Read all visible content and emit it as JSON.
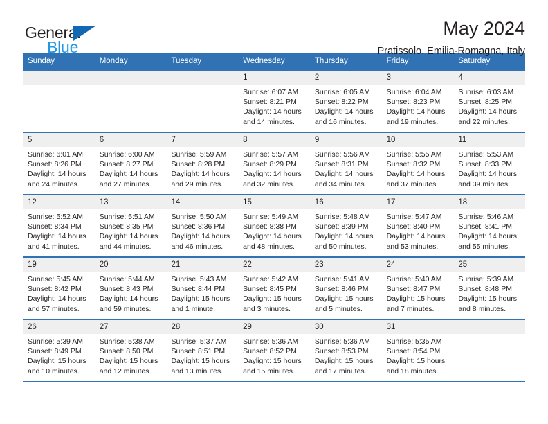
{
  "brand": {
    "name_part1": "General",
    "name_part2": "Blue",
    "triangle_color": "#1268b3",
    "blue_text_color": "#2196e3"
  },
  "header": {
    "title": "May 2024",
    "subtitle": "Pratissolo, Emilia-Romagna, Italy"
  },
  "calendar": {
    "accent_color": "#3072b3",
    "daynum_bg": "#efefef",
    "weekdays": [
      "Sunday",
      "Monday",
      "Tuesday",
      "Wednesday",
      "Thursday",
      "Friday",
      "Saturday"
    ],
    "weeks": [
      [
        {
          "day": "",
          "empty": true
        },
        {
          "day": "",
          "empty": true
        },
        {
          "day": "",
          "empty": true
        },
        {
          "day": "1",
          "sunrise": "Sunrise: 6:07 AM",
          "sunset": "Sunset: 8:21 PM",
          "daylight": "Daylight: 14 hours and 14 minutes."
        },
        {
          "day": "2",
          "sunrise": "Sunrise: 6:05 AM",
          "sunset": "Sunset: 8:22 PM",
          "daylight": "Daylight: 14 hours and 16 minutes."
        },
        {
          "day": "3",
          "sunrise": "Sunrise: 6:04 AM",
          "sunset": "Sunset: 8:23 PM",
          "daylight": "Daylight: 14 hours and 19 minutes."
        },
        {
          "day": "4",
          "sunrise": "Sunrise: 6:03 AM",
          "sunset": "Sunset: 8:25 PM",
          "daylight": "Daylight: 14 hours and 22 minutes."
        }
      ],
      [
        {
          "day": "5",
          "sunrise": "Sunrise: 6:01 AM",
          "sunset": "Sunset: 8:26 PM",
          "daylight": "Daylight: 14 hours and 24 minutes."
        },
        {
          "day": "6",
          "sunrise": "Sunrise: 6:00 AM",
          "sunset": "Sunset: 8:27 PM",
          "daylight": "Daylight: 14 hours and 27 minutes."
        },
        {
          "day": "7",
          "sunrise": "Sunrise: 5:59 AM",
          "sunset": "Sunset: 8:28 PM",
          "daylight": "Daylight: 14 hours and 29 minutes."
        },
        {
          "day": "8",
          "sunrise": "Sunrise: 5:57 AM",
          "sunset": "Sunset: 8:29 PM",
          "daylight": "Daylight: 14 hours and 32 minutes."
        },
        {
          "day": "9",
          "sunrise": "Sunrise: 5:56 AM",
          "sunset": "Sunset: 8:31 PM",
          "daylight": "Daylight: 14 hours and 34 minutes."
        },
        {
          "day": "10",
          "sunrise": "Sunrise: 5:55 AM",
          "sunset": "Sunset: 8:32 PM",
          "daylight": "Daylight: 14 hours and 37 minutes."
        },
        {
          "day": "11",
          "sunrise": "Sunrise: 5:53 AM",
          "sunset": "Sunset: 8:33 PM",
          "daylight": "Daylight: 14 hours and 39 minutes."
        }
      ],
      [
        {
          "day": "12",
          "sunrise": "Sunrise: 5:52 AM",
          "sunset": "Sunset: 8:34 PM",
          "daylight": "Daylight: 14 hours and 41 minutes."
        },
        {
          "day": "13",
          "sunrise": "Sunrise: 5:51 AM",
          "sunset": "Sunset: 8:35 PM",
          "daylight": "Daylight: 14 hours and 44 minutes."
        },
        {
          "day": "14",
          "sunrise": "Sunrise: 5:50 AM",
          "sunset": "Sunset: 8:36 PM",
          "daylight": "Daylight: 14 hours and 46 minutes."
        },
        {
          "day": "15",
          "sunrise": "Sunrise: 5:49 AM",
          "sunset": "Sunset: 8:38 PM",
          "daylight": "Daylight: 14 hours and 48 minutes."
        },
        {
          "day": "16",
          "sunrise": "Sunrise: 5:48 AM",
          "sunset": "Sunset: 8:39 PM",
          "daylight": "Daylight: 14 hours and 50 minutes."
        },
        {
          "day": "17",
          "sunrise": "Sunrise: 5:47 AM",
          "sunset": "Sunset: 8:40 PM",
          "daylight": "Daylight: 14 hours and 53 minutes."
        },
        {
          "day": "18",
          "sunrise": "Sunrise: 5:46 AM",
          "sunset": "Sunset: 8:41 PM",
          "daylight": "Daylight: 14 hours and 55 minutes."
        }
      ],
      [
        {
          "day": "19",
          "sunrise": "Sunrise: 5:45 AM",
          "sunset": "Sunset: 8:42 PM",
          "daylight": "Daylight: 14 hours and 57 minutes."
        },
        {
          "day": "20",
          "sunrise": "Sunrise: 5:44 AM",
          "sunset": "Sunset: 8:43 PM",
          "daylight": "Daylight: 14 hours and 59 minutes."
        },
        {
          "day": "21",
          "sunrise": "Sunrise: 5:43 AM",
          "sunset": "Sunset: 8:44 PM",
          "daylight": "Daylight: 15 hours and 1 minute."
        },
        {
          "day": "22",
          "sunrise": "Sunrise: 5:42 AM",
          "sunset": "Sunset: 8:45 PM",
          "daylight": "Daylight: 15 hours and 3 minutes."
        },
        {
          "day": "23",
          "sunrise": "Sunrise: 5:41 AM",
          "sunset": "Sunset: 8:46 PM",
          "daylight": "Daylight: 15 hours and 5 minutes."
        },
        {
          "day": "24",
          "sunrise": "Sunrise: 5:40 AM",
          "sunset": "Sunset: 8:47 PM",
          "daylight": "Daylight: 15 hours and 7 minutes."
        },
        {
          "day": "25",
          "sunrise": "Sunrise: 5:39 AM",
          "sunset": "Sunset: 8:48 PM",
          "daylight": "Daylight: 15 hours and 8 minutes."
        }
      ],
      [
        {
          "day": "26",
          "sunrise": "Sunrise: 5:39 AM",
          "sunset": "Sunset: 8:49 PM",
          "daylight": "Daylight: 15 hours and 10 minutes."
        },
        {
          "day": "27",
          "sunrise": "Sunrise: 5:38 AM",
          "sunset": "Sunset: 8:50 PM",
          "daylight": "Daylight: 15 hours and 12 minutes."
        },
        {
          "day": "28",
          "sunrise": "Sunrise: 5:37 AM",
          "sunset": "Sunset: 8:51 PM",
          "daylight": "Daylight: 15 hours and 13 minutes."
        },
        {
          "day": "29",
          "sunrise": "Sunrise: 5:36 AM",
          "sunset": "Sunset: 8:52 PM",
          "daylight": "Daylight: 15 hours and 15 minutes."
        },
        {
          "day": "30",
          "sunrise": "Sunrise: 5:36 AM",
          "sunset": "Sunset: 8:53 PM",
          "daylight": "Daylight: 15 hours and 17 minutes."
        },
        {
          "day": "31",
          "sunrise": "Sunrise: 5:35 AM",
          "sunset": "Sunset: 8:54 PM",
          "daylight": "Daylight: 15 hours and 18 minutes."
        },
        {
          "day": "",
          "empty": true
        }
      ]
    ]
  }
}
